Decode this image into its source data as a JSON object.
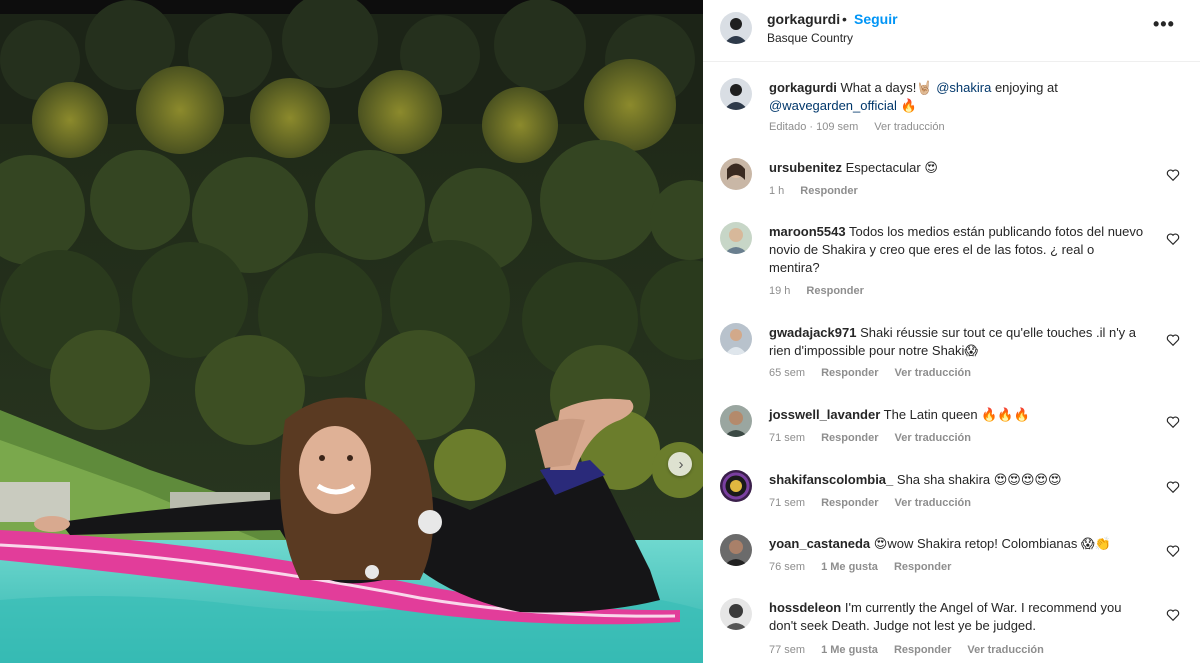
{
  "post": {
    "username": "gorkagurdi",
    "separator": "•",
    "follow_label": "Seguir",
    "location": "Basque Country",
    "more_label": "•••",
    "next_arrow": "›"
  },
  "caption": {
    "username": "gorkagurdi",
    "text_1": "What a days!",
    "emoji_1": "🤘🏼",
    "mention_1": "@shakira",
    "text_2": "enjoying at",
    "mention_2": "@wavegarden_official",
    "emoji_2": "🔥",
    "meta": [
      "Editado · 109 sem",
      "Ver traducción"
    ]
  },
  "comments": [
    {
      "username": "ursubenitez",
      "text": "Espectacular 😍",
      "meta": [
        "1 h",
        "Responder"
      ]
    },
    {
      "username": "maroon5543",
      "text": "Todos los medios están publicando fotos del nuevo novio de Shakira y creo que eres el de las fotos. ¿ real o mentira?",
      "meta": [
        "19 h",
        "Responder"
      ]
    },
    {
      "username": "gwadajack971",
      "text": "Shaki réussie sur tout ce qu'elle touches .il n'y a rien d'impossible pour notre Shaki😱",
      "meta": [
        "65 sem",
        "Responder",
        "Ver traducción"
      ]
    },
    {
      "username": "josswell_lavander",
      "text": "The Latin queen 🔥🔥🔥",
      "meta": [
        "71 sem",
        "Responder",
        "Ver traducción"
      ]
    },
    {
      "username": "shakifanscolombia_",
      "text": "Sha sha shakira 😍😍😍😍😍",
      "meta": [
        "71 sem",
        "Responder",
        "Ver traducción"
      ]
    },
    {
      "username": "yoan_castaneda",
      "text": "😍wow Shakira retop! Colombianas 😱👏",
      "meta": [
        "76 sem",
        "1 Me gusta",
        "Responder"
      ]
    },
    {
      "username": "hossdeleon",
      "text": "I'm currently the Angel of War. I recommend you don't seek Death. Judge not lest ye be judged.",
      "meta": [
        "77 sem",
        "1 Me gusta",
        "Responder",
        "Ver traducción"
      ]
    }
  ],
  "colors": {
    "follow": "#0095f6",
    "mention": "#00376b",
    "meta": "#8e8e8e",
    "surfboard": "#e23d9a",
    "water": "#3fc7c0"
  }
}
